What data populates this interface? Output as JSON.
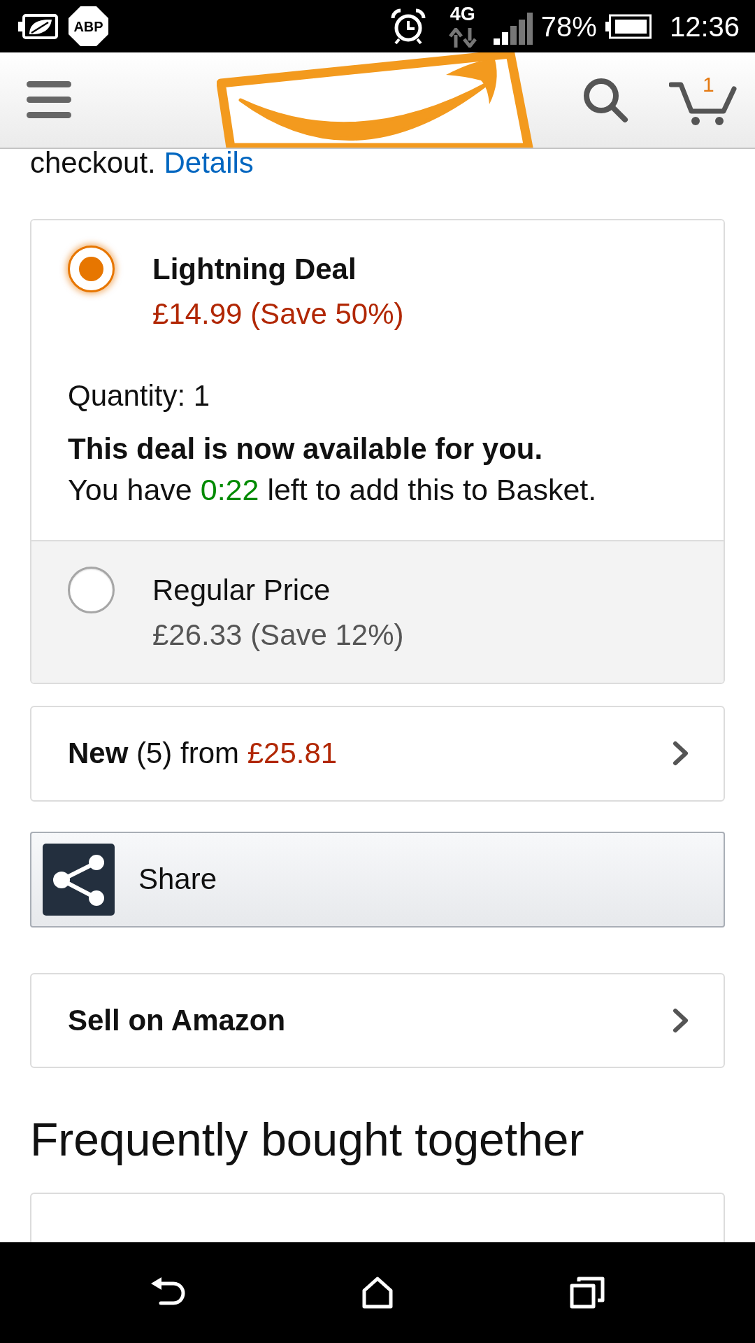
{
  "status_bar": {
    "adblock_label": "ABP",
    "network": "4G",
    "battery": "78%",
    "time": "12:36"
  },
  "header": {
    "cart_count": "1"
  },
  "intro": {
    "text": "checkout.",
    "link": "Details"
  },
  "offers": [
    {
      "title": "Lightning Deal",
      "price": "£14.99 (Save 50%)",
      "selected": true,
      "quantity": "Quantity: 1",
      "notice": "This deal is now available for you.",
      "countdown": {
        "before": "You have",
        "time": "0:22",
        "after": "left to add this to Basket."
      }
    },
    {
      "title": "Regular Price",
      "price": "£26.33 (Save 12%)",
      "selected": false
    }
  ],
  "new_offers": {
    "label": "**New** (5) from",
    "price": "£25.81"
  },
  "share_button": {
    "label": "Share"
  },
  "sell_link": {
    "label": "Sell on Amazon"
  },
  "section": {
    "title": "Frequently bought together"
  }
}
